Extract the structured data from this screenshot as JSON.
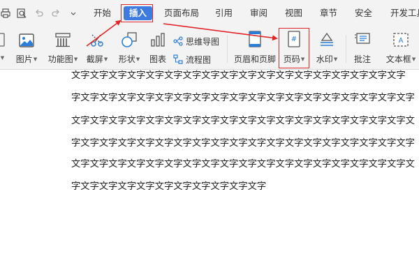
{
  "menu": {
    "tabs": [
      "开始",
      "插入",
      "页面布局",
      "引用",
      "审阅",
      "视图",
      "章节",
      "安全",
      "开发工具"
    ],
    "active_tab": "插入"
  },
  "ribbon": {
    "picture": "图片",
    "function_chart": "功能图",
    "screenshot": "截屏",
    "shape": "形状",
    "chart": "图表",
    "mind_map": "思维导图",
    "flowchart": "流程图",
    "header_footer": "页眉和页脚",
    "page_number": "页码",
    "watermark": "水印",
    "comment": "批注",
    "text_box": "文本框"
  },
  "document": {
    "lines": [
      "文字文字文字文字文字文字文字文字文字文字文字文字文字文字文字文字文字文字",
      "字文字文字文字文字文字文字文字文字文字文字文字文字文字文字文字文字文字文字",
      "文字文字文字文字文字文字文字文字文字文字文字文字文字文字文字文字文字文字文",
      "字文字文字文字文字文字文字文字文字文字文字文字文字文字文字文字文字文字文字",
      "文字文字文字文字文字文字文字文字文字文字文字文字文字文字文字文字文字文字文",
      "字文字文字文字文字文字文字文字文字文字文字"
    ]
  },
  "colors": {
    "accent": "#3d7be0",
    "highlight": "#e0242a"
  }
}
